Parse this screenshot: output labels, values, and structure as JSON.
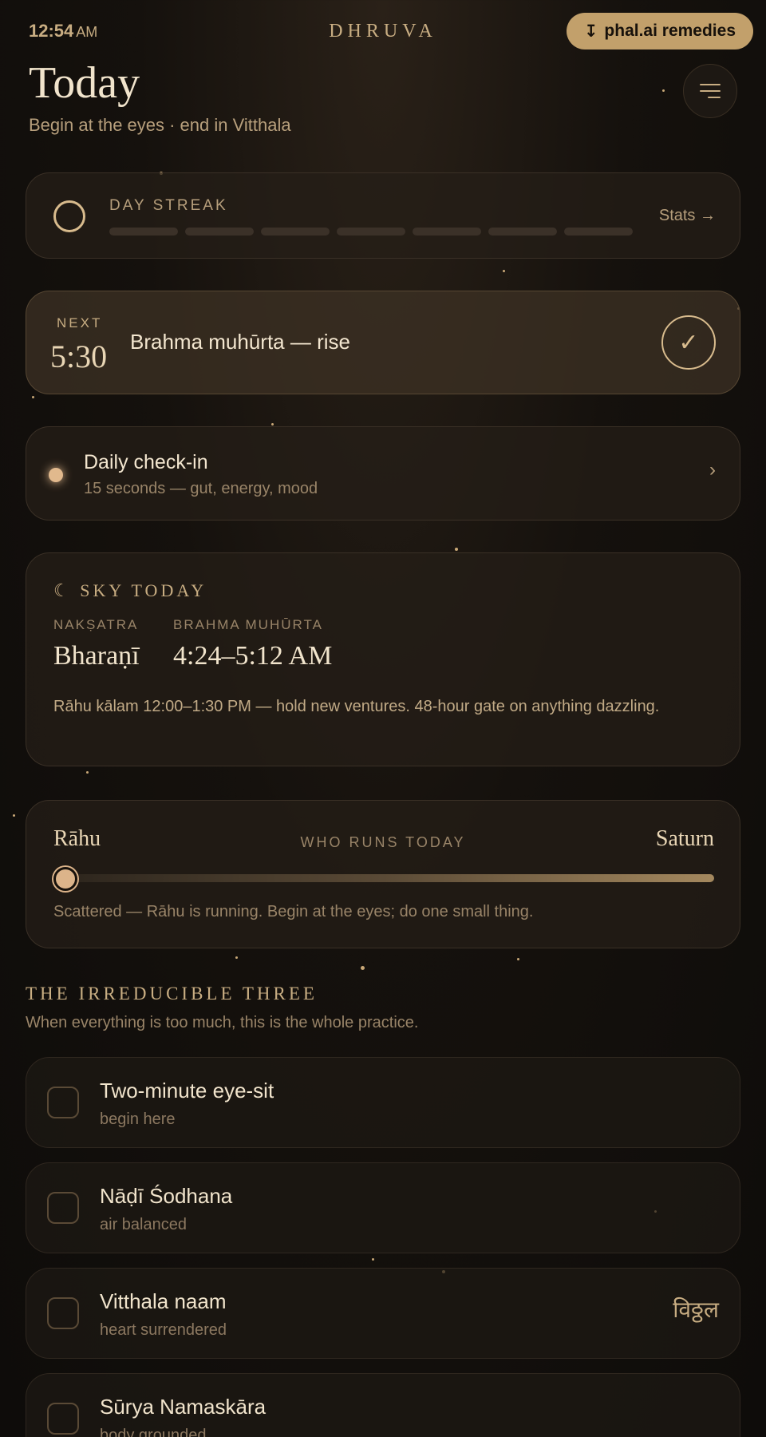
{
  "status": {
    "time": "12:54",
    "ampm": "AM"
  },
  "header": {
    "brand": "DHRUVA",
    "remedy_button": "phal.ai remedies",
    "title": "Today",
    "subtitle": "Begin at the eyes · end in Vitthala"
  },
  "streak": {
    "label": "DAY STREAK",
    "link": "Stats →",
    "segments_filled": 0,
    "segments_total": 7
  },
  "next": {
    "label": "NEXT",
    "time": "5:30",
    "text": "Brahma muhūrta — rise"
  },
  "checkin": {
    "title": "Daily check-in",
    "subtitle": "15 seconds — gut, energy, mood"
  },
  "sky": {
    "heading": "☾ SKY TODAY",
    "naksatra_label": "NAKṢATRA",
    "naksatra_value": "Bharaṇī",
    "brahma_label": "BRAHMA MUHŪRTA",
    "brahma_value": "4:24–5:12 AM",
    "note": "Rāhu kālam 12:00–1:30 PM — hold new ventures. 48-hour gate on anything dazzling."
  },
  "who_runs": {
    "left": "Rāhu",
    "label": "WHO RUNS TODAY",
    "right": "Saturn",
    "position": 0.0,
    "note": "Scattered — Rāhu is running. Begin at the eyes; do one small thing."
  },
  "irreducible": {
    "heading": "THE IRREDUCIBLE THREE",
    "subtitle": "When everything is too much, this is the whole practice.",
    "items": [
      {
        "title": "Two-minute eye-sit",
        "subtitle": "begin here",
        "deva": ""
      },
      {
        "title": "Nāḍī Śodhana",
        "subtitle": "air balanced",
        "deva": ""
      },
      {
        "title": "Vitthala naam",
        "subtitle": "heart surrendered",
        "deva": "विठ्ठल"
      },
      {
        "title": "Sūrya Namaskāra",
        "subtitle": "body grounded",
        "deva": ""
      }
    ]
  },
  "colors": {
    "accent": "#c2a06b",
    "background": "#15110d",
    "text": "#efe3cf"
  }
}
